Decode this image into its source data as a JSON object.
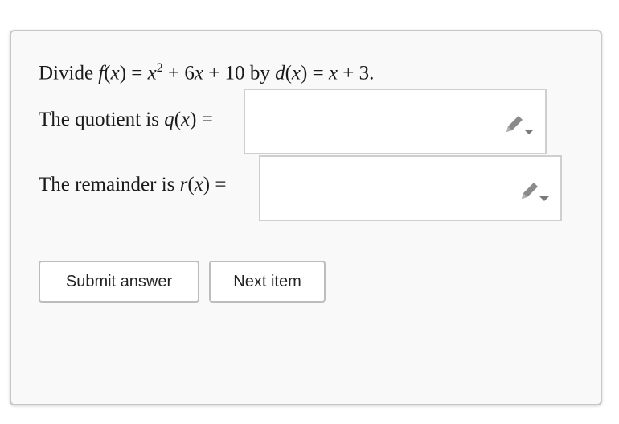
{
  "problem": {
    "divide_word": "Divide",
    "f_name": "f",
    "f_arg_open": "(",
    "f_var": "x",
    "f_arg_close": ")",
    "eq1": " = ",
    "x_base": "x",
    "exponent": "2",
    "plus_1": " + 6",
    "x_term": "x",
    "plus_2": " + 10 ",
    "by_word": "by ",
    "d_name": "d",
    "d_arg_open": "(",
    "d_var": "x",
    "d_arg_close": ")",
    "eq2": " = ",
    "d_x": "x",
    "d_tail": " + 3."
  },
  "quotient": {
    "label_text": "The quotient is ",
    "fn": "q",
    "open": "(",
    "var": "x",
    "close": ")",
    "eq": " =",
    "value": ""
  },
  "remainder": {
    "label_text": "The remainder is ",
    "fn": "r",
    "open": "(",
    "var": "x",
    "close": ")",
    "eq": " =",
    "value": ""
  },
  "icons": {
    "edit": "pencil-icon",
    "dropdown": "caret-down-icon"
  },
  "buttons": {
    "submit_label": "Submit answer",
    "next_label": "Next item"
  }
}
